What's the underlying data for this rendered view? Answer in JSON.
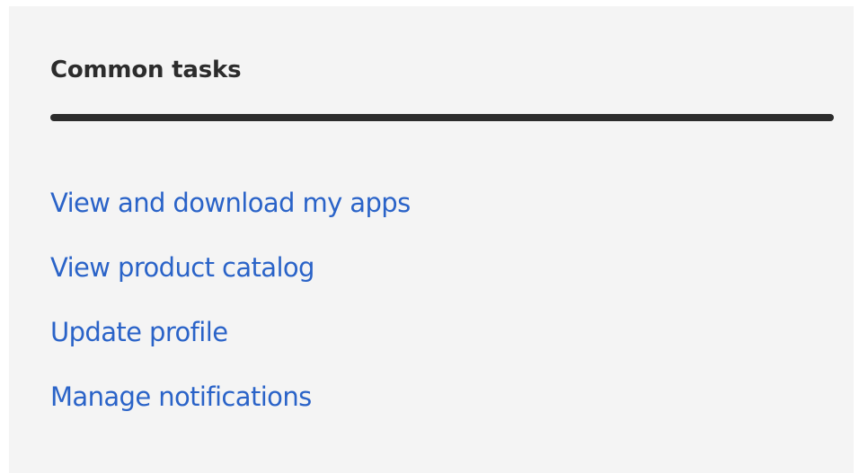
{
  "common_tasks": {
    "heading": "Common tasks",
    "links": [
      {
        "label": "View and download my apps"
      },
      {
        "label": "View product catalog"
      },
      {
        "label": "Update profile"
      },
      {
        "label": "Manage notifications"
      }
    ]
  },
  "colors": {
    "panel_background": "#f4f4f4",
    "heading_text": "#2c2c2c",
    "divider": "#2c2c2c",
    "link_text": "#2a63c8"
  }
}
